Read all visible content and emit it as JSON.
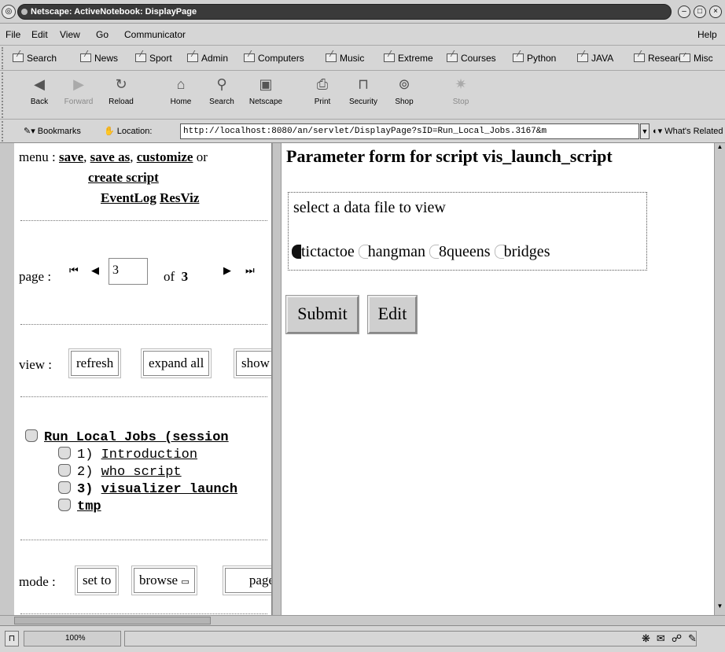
{
  "window": {
    "title": "Netscape: ActiveNotebook: DisplayPage"
  },
  "menubar": {
    "items": [
      "File",
      "Edit",
      "View",
      "Go",
      "Communicator"
    ],
    "help": "Help"
  },
  "personal_toolbar": {
    "items": [
      "Search",
      "News",
      "Sport",
      "Admin",
      "Computers",
      "Music",
      "Extreme",
      "Courses",
      "Python",
      "JAVA",
      "Research",
      "Misc"
    ]
  },
  "nav_toolbar": {
    "buttons": [
      {
        "label": "Back",
        "icon": "back-arrow-icon",
        "enabled": true
      },
      {
        "label": "Forward",
        "icon": "forward-arrow-icon",
        "enabled": false
      },
      {
        "label": "Reload",
        "icon": "reload-icon",
        "enabled": true
      },
      {
        "label": "Home",
        "icon": "home-icon",
        "enabled": true
      },
      {
        "label": "Search",
        "icon": "search-icon",
        "enabled": true
      },
      {
        "label": "Netscape",
        "icon": "netscape-icon",
        "enabled": true
      },
      {
        "label": "Print",
        "icon": "print-icon",
        "enabled": true
      },
      {
        "label": "Security",
        "icon": "lock-icon",
        "enabled": true
      },
      {
        "label": "Shop",
        "icon": "shop-icon",
        "enabled": true
      },
      {
        "label": "Stop",
        "icon": "stop-icon",
        "enabled": false
      }
    ]
  },
  "location_bar": {
    "bookmarks": "Bookmarks",
    "location_label": "Location:",
    "url": "http://localhost:8080/an/servlet/DisplayPage?sID=Run_Local_Jobs.3167&m",
    "whats_related": "What's Related"
  },
  "left_frame": {
    "menu_prefix": "menu :",
    "menu_links": [
      "save",
      "save as",
      "customize"
    ],
    "menu_or": "or",
    "sep": ",",
    "create_script": "create script",
    "eventlog": "EventLog",
    "resviz": "ResViz",
    "page_label": "page :",
    "page_value": "3",
    "page_of": "of",
    "page_total": "3",
    "view_label": "view :",
    "view_buttons": [
      "refresh",
      "expand all",
      "show"
    ],
    "tree": {
      "root": "Run_Local_Jobs (session",
      "items": [
        {
          "num": "1)",
          "label": "Introduction",
          "bold": false
        },
        {
          "num": "2)",
          "label": "who_script",
          "bold": false
        },
        {
          "num": "3)",
          "label": "visualizer_launch",
          "bold": true
        }
      ],
      "tmp": "tmp"
    },
    "mode_label": "mode :",
    "mode_buttons": [
      "set to",
      "browse",
      "page"
    ]
  },
  "right_frame": {
    "title": "Parameter form for script vis_launch_script",
    "field_label": "select a data file to view",
    "options": [
      "tictactoe",
      "hangman",
      "8queens",
      "bridges"
    ],
    "selected": "tictactoe",
    "submit": "Submit",
    "edit": "Edit"
  },
  "status_bar": {
    "progress": "100%"
  }
}
